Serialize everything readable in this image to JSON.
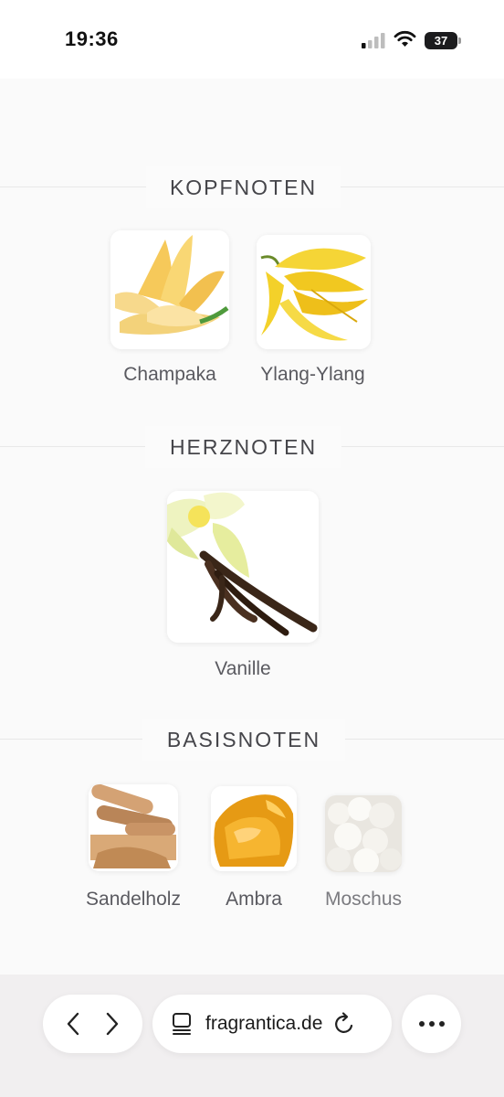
{
  "status_bar": {
    "time": "19:36",
    "battery": "37"
  },
  "sections": {
    "top": {
      "title": "KOPFNOTEN"
    },
    "heart": {
      "title": "HERZNOTEN"
    },
    "base": {
      "title": "BASISNOTEN"
    }
  },
  "notes": {
    "champaka": "Champaka",
    "ylang": "Ylang-Ylang",
    "vanille": "Vanille",
    "sandelholz": "Sandelholz",
    "ambra": "Ambra",
    "moschus": "Moschus"
  },
  "browser": {
    "url": "fragrantica.de",
    "icons": [
      "chevron-left-icon",
      "chevron-right-icon",
      "tab-icon",
      "reload-icon",
      "more-icon"
    ]
  }
}
